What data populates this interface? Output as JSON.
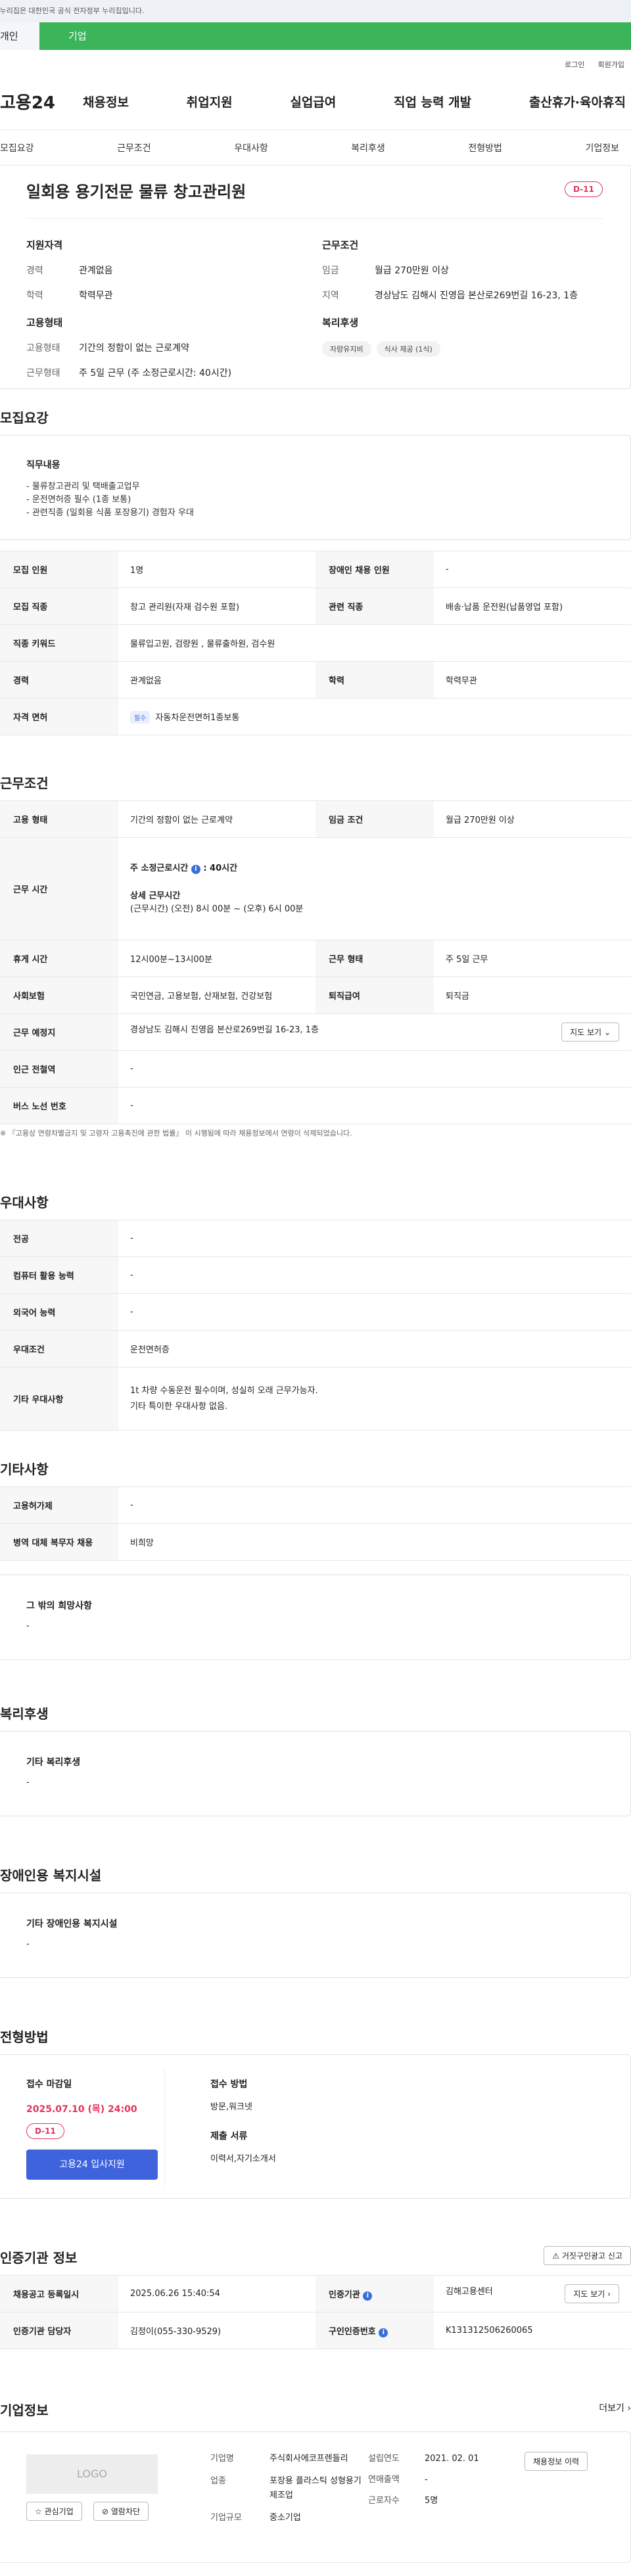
{
  "gov_bar": "이 누리집은 대한민국 공식 전자정부 누리집입니다.",
  "role_tabs": {
    "personal": "개인",
    "company": "기업"
  },
  "util": {
    "login": "로그인",
    "join": "회원가입"
  },
  "logo": "고용24",
  "gnb": [
    "채용정보",
    "취업지원",
    "실업급여",
    "직업 능력 개발",
    "출산휴가·육아휴직"
  ],
  "subnav": [
    "모집요강",
    "근무조건",
    "우대사항",
    "복리후생",
    "전형방법",
    "기업정보"
  ],
  "summary": {
    "title": "일회용 용기전문 물류 창고관리원",
    "dday": "D-11",
    "qual_heading": "지원자격",
    "career_label": "경력",
    "career": "관계없음",
    "edu_label": "학력",
    "edu": "학력무관",
    "work_heading": "근무조건",
    "wage_label": "임금",
    "wage": "월급 270만원 이상",
    "area_label": "지역",
    "area": "경상남도 김해시 진영읍 본산로269번길 16-23, 1층",
    "emp_heading": "고용형태",
    "emp_type_label": "고용형태",
    "emp_type": "기간의 정함이 없는 근로계약",
    "work_form_label": "근무형태",
    "work_form": "주 5일 근무 (주 소정근로시간: 40시간)",
    "welfare_heading": "복리후생",
    "welfare_chips": [
      "자량유지비",
      "식사 제공 (1식)"
    ]
  },
  "recruit": {
    "title": "모집요강",
    "duty_heading": "직무내용",
    "duty_lines": [
      "- 물류창고관리 및 택배출고업무",
      "- 운전면허증 필수 (1종 보통)",
      "- 관련직종 (일회용 식품 포장용기) 경험자 우대"
    ],
    "rows": [
      {
        "k1": "모집 인원",
        "v1": "1명",
        "k2": "장애인 채용 인원",
        "v2": "-"
      },
      {
        "k1": "모집 직종",
        "v1": "창고 관리원(자재 검수원 포함)",
        "k2": "관련 직종",
        "v2": "배송·납품 운전원(납품영업 포함)"
      },
      {
        "k1": "직종 키워드",
        "v1": "물류입고원, 검량원 , 물류출하원, 검수원"
      },
      {
        "k1": "경력",
        "v1": "관계없음",
        "k2": "학력",
        "v2": "학력무관"
      }
    ],
    "license_label": "자격 면허",
    "license_badge": "필수",
    "license": "자동차운전면허1종보통"
  },
  "work": {
    "title": "근무조건",
    "emp_label": "고용 형태",
    "emp": "기간의 정함이 없는 근로계약",
    "wage_label": "임금 조건",
    "wage": "월급 270만원 이상",
    "hours_label": "근무 시간",
    "weekly": "주 소정근로시간",
    "weekly_val": ": 40시간",
    "detail_head": "상세 근무시간",
    "detail": "(근무시간) (오전) 8시 00분 ~ (오후) 6시 00분",
    "rest_label": "휴게 시간",
    "rest": "12시00분~13시00분",
    "form_label": "근무 형태",
    "form": "주 5일 근무",
    "ins_label": "사회보험",
    "ins": "국민연금, 고용보험, 산재보험, 건강보험",
    "sev_label": "퇴직급여",
    "sev": "퇴직금",
    "place_label": "근무 예정지",
    "place": "경상남도 김해시 진영읍 본산로269번길 16-23, 1층",
    "map_btn": "지도 보기",
    "subway_label": "인근 전철역",
    "subway": "-",
    "bus_label": "버스 노선 번호",
    "bus": "-",
    "note": "※ 『고용상 연령차별금지 및 고령자 고용촉진에 관한 법률』 이 시행됨에 따라 채용정보에서 연령이 삭제되었습니다."
  },
  "pref": {
    "title": "우대사항",
    "rows": [
      {
        "k": "전공",
        "v": "-"
      },
      {
        "k": "컴퓨터 활용 능력",
        "v": "-"
      },
      {
        "k": "외국어 능력",
        "v": "-"
      },
      {
        "k": "우대조건",
        "v": "운전면허증"
      }
    ],
    "etc_label": "기타 우대사항",
    "etc1": "1t 차량 수동운전 필수이며, 성실히 오래 근무가능자.",
    "etc2": "기타 특이한 우대사항 없음."
  },
  "other": {
    "title": "기타사항",
    "rows": [
      {
        "k": "고용허가제",
        "v": "-"
      },
      {
        "k": "병역 대체 복무자 채용",
        "v": "비희망"
      }
    ],
    "hope_heading": "그 밖의 희망사항",
    "hope": "-"
  },
  "welfare": {
    "title": "복리후생",
    "heading": "기타 복리후생",
    "value": "-"
  },
  "disabled": {
    "title": "장애인용 복지시설",
    "heading": "기타 장애인용 복지시설",
    "value": "-"
  },
  "selection": {
    "title": "전형방법",
    "deadline_head": "접수 마감일",
    "deadline": "2025.07.10 (목) 24:00",
    "dday": "D-11",
    "apply": "고용24 입사지원",
    "method_head": "접수 방법",
    "method": "방문,워크넷",
    "docs_head": "제출 서류",
    "docs": "이력서,자기소개서"
  },
  "cert": {
    "title": "인증기관 정보",
    "report_btn": "거짓구인광고 신고",
    "reg_label": "채용공고 등록일시",
    "reg": "2025.06.26 15:40:54",
    "org_label": "인증기관",
    "org": "김해고용센터",
    "map_btn": "지도 보기",
    "staff_label": "인증기관 담당자",
    "staff": "김정이(055-330-9529)",
    "num_label": "구인인증번호",
    "num": "K131312506260065"
  },
  "company": {
    "title": "기업정보",
    "more": "더보기",
    "logo": "LOGO",
    "fav": "관심기업",
    "block": "열람차단",
    "name_label": "기업명",
    "name": "주식회사에코프렌들리",
    "ind_label": "업종",
    "ind": "포장용 플라스틱 성형용기 제조업",
    "size_label": "기업규모",
    "size": "중소기업",
    "est_label": "설립연도",
    "est": "2021. 02. 01",
    "sales_label": "연매출액",
    "sales": "-",
    "emp_label": "근로자수",
    "emp": "5명",
    "history_btn": "채용정보 이력"
  }
}
